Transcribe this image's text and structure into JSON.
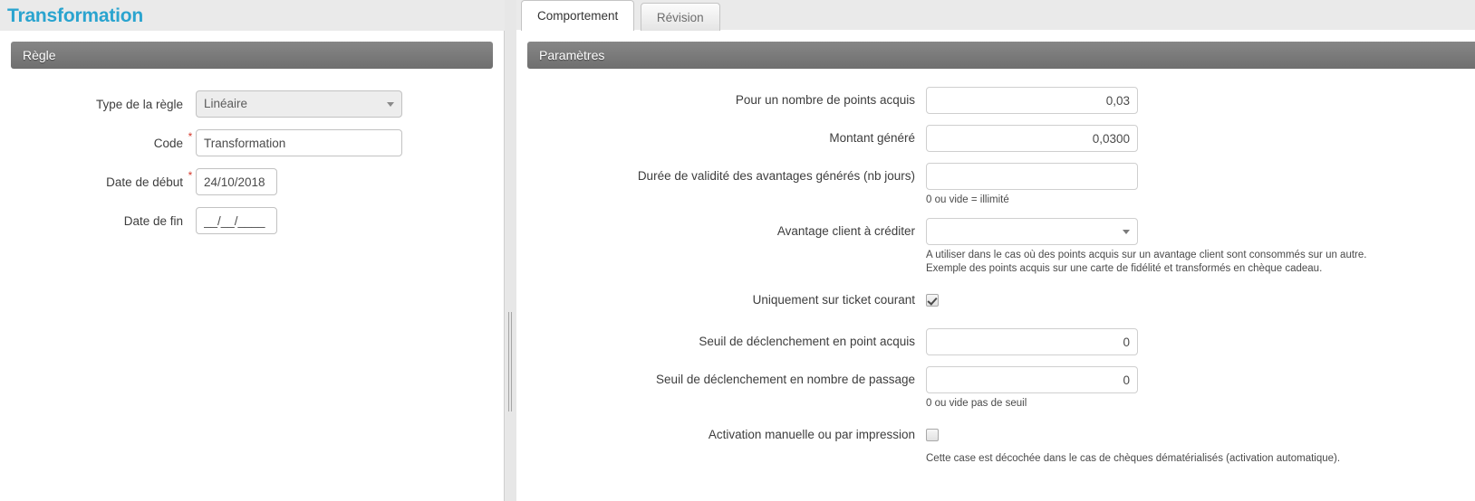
{
  "page": {
    "title": "Transformation"
  },
  "left": {
    "section_label": "Règle",
    "fields": {
      "rule_type": {
        "label": "Type de la règle",
        "value": "Linéaire",
        "options": [
          "Linéaire"
        ]
      },
      "code": {
        "label": "Code",
        "value": "Transformation",
        "required_marker": "*"
      },
      "start_date": {
        "label": "Date de début",
        "value": "24/10/2018",
        "required_marker": "*"
      },
      "end_date": {
        "label": "Date de fin",
        "value": "__/__/____"
      }
    }
  },
  "right": {
    "tabs": [
      {
        "label": "Comportement",
        "active": true
      },
      {
        "label": "Révision",
        "active": false
      }
    ],
    "section_label": "Paramètres",
    "fields": {
      "points_acquired": {
        "label": "Pour un nombre de points acquis",
        "value": "0,03"
      },
      "amount_generated": {
        "label": "Montant généré",
        "value": "0,0300"
      },
      "validity_duration": {
        "label": "Durée de validité des avantages générés (nb jours)",
        "value": "",
        "hint": "0 ou vide = illimité"
      },
      "client_benefit": {
        "label": "Avantage client à créditer",
        "value": "",
        "hint_line1": "A utiliser dans le cas où des points acquis sur un avantage client sont consommés sur un autre.",
        "hint_line2": "Exemple des points acquis sur une carte de fidélité et transformés en chèque cadeau."
      },
      "only_current_ticket": {
        "label": "Uniquement sur ticket courant",
        "checked": true
      },
      "threshold_points": {
        "label": "Seuil de déclenchement en point acquis",
        "value": "0"
      },
      "threshold_passages": {
        "label": "Seuil de déclenchement en nombre de passage",
        "value": "0",
        "hint": "0 ou vide pas de seuil"
      },
      "manual_activation": {
        "label": "Activation manuelle ou par impression",
        "checked": false,
        "hint": "Cette case est décochée dans le cas de chèques dématérialisés (activation automatique)."
      }
    }
  },
  "colors": {
    "title_accent": "#2aa4cf",
    "section_bar": "#7a7a7a",
    "required_marker": "#d63a2e"
  }
}
